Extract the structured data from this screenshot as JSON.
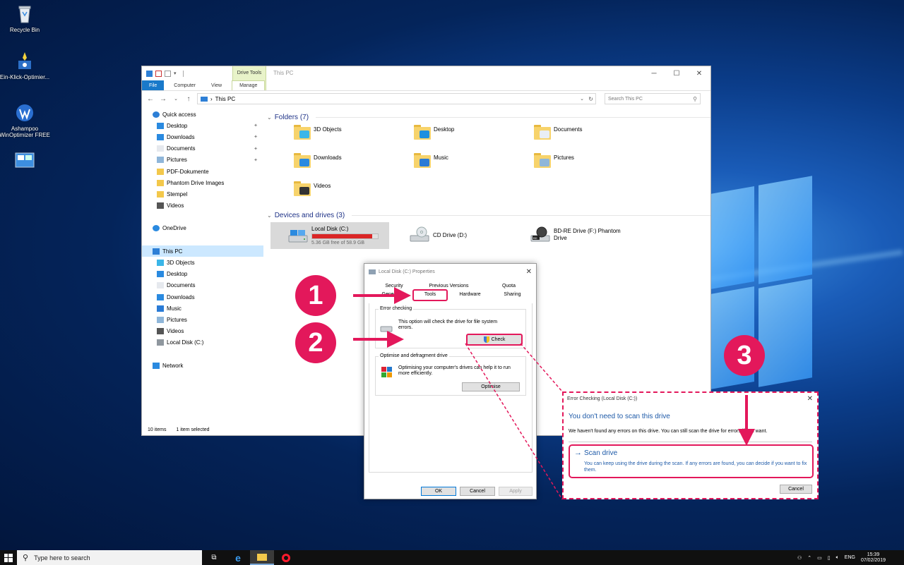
{
  "desktop": {
    "icons": [
      {
        "label": "Recycle Bin"
      },
      {
        "label": "Ein-Klick-Optimier..."
      },
      {
        "label": "Ashampoo WinOptimizer FREE"
      },
      {
        "label": ""
      }
    ]
  },
  "explorer": {
    "title": "This PC",
    "contextual_tab_group": "Drive Tools",
    "tabs": [
      "File",
      "Computer",
      "View",
      "Manage"
    ],
    "address": "This PC",
    "address_sep": "›",
    "search_placeholder": "Search This PC",
    "nav": [
      {
        "label": "Quick access",
        "icon": "star-icon",
        "indent": 0,
        "pinned": false
      },
      {
        "label": "Desktop",
        "icon": "desktop-icon",
        "indent": 1,
        "pinned": true
      },
      {
        "label": "Downloads",
        "icon": "download-icon",
        "indent": 1,
        "pinned": true
      },
      {
        "label": "Documents",
        "icon": "document-icon",
        "indent": 1,
        "pinned": true
      },
      {
        "label": "Pictures",
        "icon": "picture-icon",
        "indent": 1,
        "pinned": true
      },
      {
        "label": "PDF-Dokumente",
        "icon": "folder-icon",
        "indent": 1,
        "pinned": false
      },
      {
        "label": "Phantom Drive Images",
        "icon": "folder-icon",
        "indent": 1,
        "pinned": false
      },
      {
        "label": "Stempel",
        "icon": "folder-icon",
        "indent": 1,
        "pinned": false
      },
      {
        "label": "Videos",
        "icon": "video-icon",
        "indent": 1,
        "pinned": false
      },
      {
        "label": "",
        "icon": "",
        "indent": 0,
        "pinned": false
      },
      {
        "label": "OneDrive",
        "icon": "cloud-icon",
        "indent": 0,
        "pinned": false
      },
      {
        "label": "",
        "icon": "",
        "indent": 0,
        "pinned": false
      },
      {
        "label": "This PC",
        "icon": "computer-icon",
        "indent": 0,
        "pinned": false,
        "selected": true
      },
      {
        "label": "3D Objects",
        "icon": "cube-icon",
        "indent": 1,
        "pinned": false
      },
      {
        "label": "Desktop",
        "icon": "desktop-icon",
        "indent": 1,
        "pinned": false
      },
      {
        "label": "Documents",
        "icon": "document-icon",
        "indent": 1,
        "pinned": false
      },
      {
        "label": "Downloads",
        "icon": "download-icon",
        "indent": 1,
        "pinned": false
      },
      {
        "label": "Music",
        "icon": "music-icon",
        "indent": 1,
        "pinned": false
      },
      {
        "label": "Pictures",
        "icon": "picture-icon",
        "indent": 1,
        "pinned": false
      },
      {
        "label": "Videos",
        "icon": "video-icon",
        "indent": 1,
        "pinned": false
      },
      {
        "label": "Local Disk (C:)",
        "icon": "drive-icon",
        "indent": 1,
        "pinned": false
      },
      {
        "label": "",
        "icon": "",
        "indent": 0,
        "pinned": false
      },
      {
        "label": "Network",
        "icon": "network-icon",
        "indent": 0,
        "pinned": false
      }
    ],
    "folders_header": "Folders (7)",
    "folders": [
      {
        "name": "3D Objects",
        "overlay": "#3bb6e8"
      },
      {
        "name": "Desktop",
        "overlay": "#1e8fe0"
      },
      {
        "name": "Documents",
        "overlay": "#e9eef5"
      },
      {
        "name": "Downloads",
        "overlay": "#2a8ae0"
      },
      {
        "name": "Music",
        "overlay": "#2a7bd6"
      },
      {
        "name": "Pictures",
        "overlay": "#8fb6d9"
      },
      {
        "name": "Videos",
        "overlay": "#333333"
      }
    ],
    "devices_header": "Devices and drives (3)",
    "drives": [
      {
        "name": "Local Disk (C:)",
        "free": "5.36 GB free of 58.9 GB",
        "used_fraction": 0.91
      },
      {
        "name": "CD Drive (D:)"
      },
      {
        "name": "BD-RE Drive (F:) Phantom Drive"
      }
    ],
    "status": {
      "items": "10 items",
      "selected": "1 item selected"
    }
  },
  "properties": {
    "title": "Local Disk (C:) Properties",
    "tabs_row1": [
      "Security",
      "Previous Versions",
      "Quota"
    ],
    "tabs_row2": [
      "General",
      "Tools",
      "Hardware",
      "Sharing"
    ],
    "error_checking": {
      "legend": "Error checking",
      "text": "This option will check the drive for file system errors.",
      "button": "Check"
    },
    "optimise": {
      "legend": "Optimise and defragment drive",
      "text": "Optimising your computer's drives can help it to run more efficiently.",
      "button": "Optimise"
    },
    "footer": {
      "ok": "OK",
      "cancel": "Cancel",
      "apply": "Apply"
    }
  },
  "error_dialog": {
    "title": "Error Checking (Local Disk (C:))",
    "heading": "You don't need to scan this drive",
    "message": "We haven't found any errors on this drive. You can still scan the drive for errors if you want.",
    "option_title": "Scan drive",
    "option_desc": "You can keep using the drive during the scan. If any errors are found, you can decide if you want to fix them.",
    "cancel": "Cancel"
  },
  "steps": [
    "1",
    "2",
    "3"
  ],
  "taskbar": {
    "search_placeholder": "Type here to search",
    "lang": "ENG",
    "time": "15:39",
    "date": "07/02/2019"
  },
  "colors": {
    "accent": "#e3185b",
    "link": "#1e5aa8",
    "selection": "#cce8ff",
    "usage_bar": "#da2626"
  }
}
